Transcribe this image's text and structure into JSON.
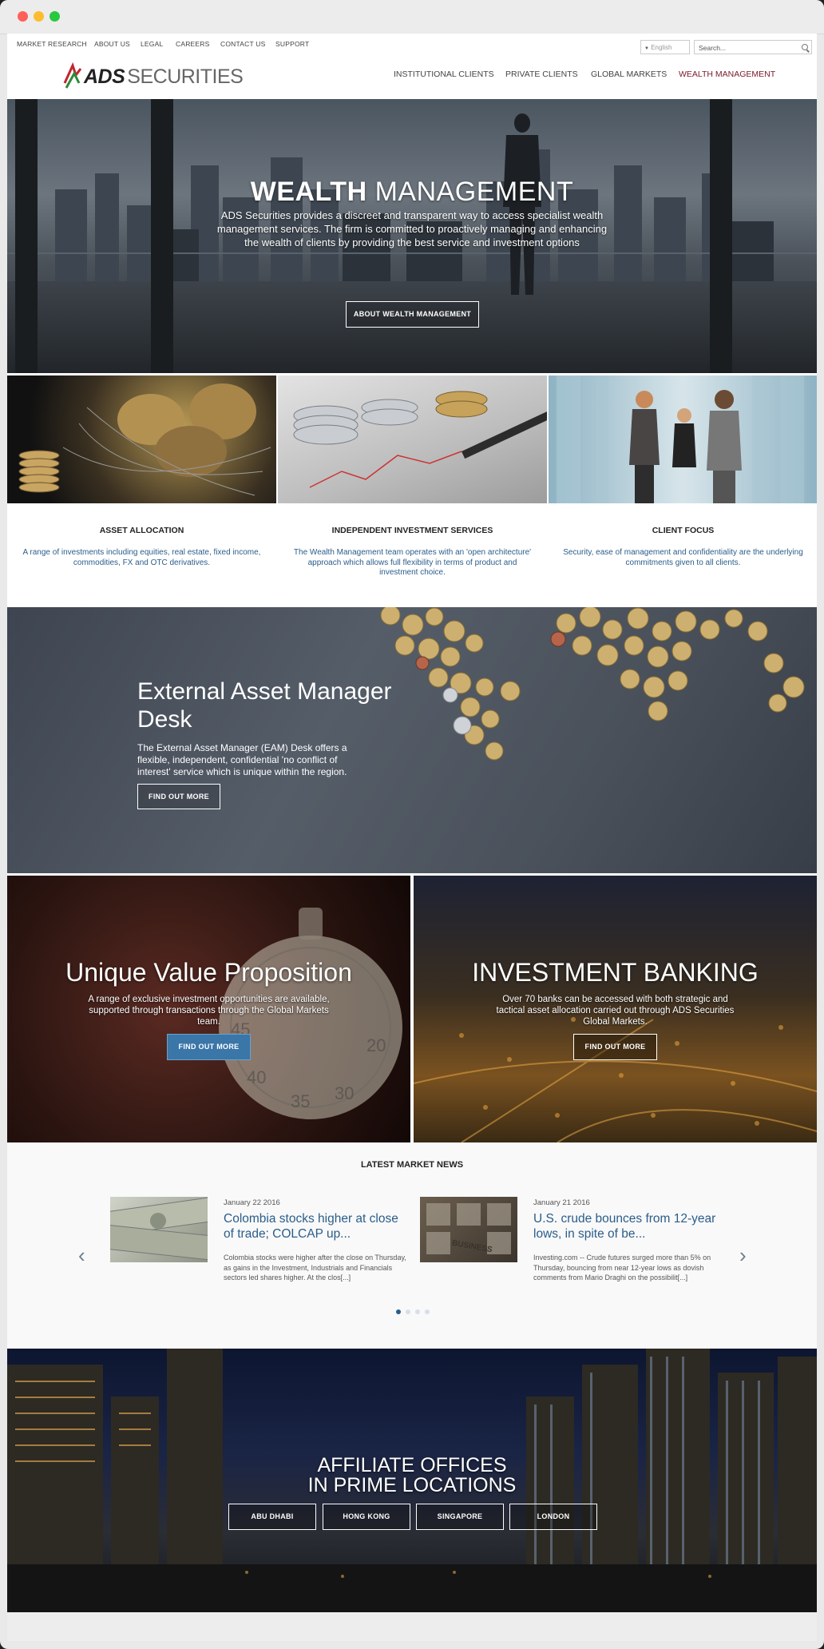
{
  "utility_nav": [
    "MARKET RESEARCH",
    "ABOUT US",
    "LEGAL",
    "CAREERS",
    "CONTACT US",
    "SUPPORT"
  ],
  "language": {
    "selected": "English"
  },
  "search": {
    "placeholder": "Search..."
  },
  "logo": {
    "brand": "ADS",
    "name": "SECURITIES"
  },
  "main_nav": [
    {
      "label": "INSTITUTIONAL CLIENTS",
      "active": false
    },
    {
      "label": "PRIVATE CLIENTS",
      "active": false
    },
    {
      "label": "GLOBAL MARKETS",
      "active": false
    },
    {
      "label": "WEALTH MANAGEMENT",
      "active": true
    }
  ],
  "hero": {
    "title_bold": "WEALTH",
    "title_rest": " MANAGEMENT",
    "text": "ADS Securities provides a discreet and transparent way to access specialist wealth management services. The firm is committed to proactively managing and enhancing the wealth of clients by providing the best service and investment options",
    "button": "ABOUT WEALTH MANAGEMENT"
  },
  "cards": [
    {
      "title": "ASSET ALLOCATION",
      "text": "A range of investments including equities, real estate, fixed income, commodities, FX and OTC derivatives."
    },
    {
      "title": "INDEPENDENT INVESTMENT SERVICES",
      "text": "The Wealth Management team operates with an 'open architecture' approach which allows full flexibility in terms of product and investment choice."
    },
    {
      "title": "CLIENT FOCUS",
      "text": "Security, ease of management and confidentiality are the underlying commitments given to all clients."
    }
  ],
  "eam": {
    "title": "External Asset Manager Desk",
    "text": "The External Asset Manager (EAM) Desk offers a flexible, independent, confidential 'no conflict of interest' service which is unique within the region.",
    "button": "FIND OUT MORE"
  },
  "uvp": {
    "title": "Unique Value Proposition",
    "text": "A range of exclusive investment opportunities are available, supported through transactions through the Global Markets team.",
    "button": "FIND OUT MORE"
  },
  "ib": {
    "title": "INVESTMENT BANKING",
    "text": "Over 70 banks can be accessed with both strategic and tactical asset allocation carried out through ADS Securities Global Markets.",
    "button": "FIND OUT MORE"
  },
  "news": {
    "heading": "LATEST MARKET NEWS",
    "prev_icon": "chevron-left-icon",
    "next_icon": "chevron-right-icon",
    "items": [
      {
        "date": "January 22 2016",
        "title": "Colombia stocks higher at close of trade; COLCAP up...",
        "excerpt": "Colombia stocks were higher after the close on Thursday, as gains in the Investment, Industrials and Financials sectors led shares higher. At the clos[...]"
      },
      {
        "date": "January 21 2016",
        "title": "U.S. crude bounces from 12-year lows, in spite of be...",
        "excerpt": "Investing.com -- Crude futures surged more than 5% on Thursday, bouncing from near 12-year lows as dovish comments from Mario Draghi on the possibilit[...]"
      }
    ],
    "pages": 4,
    "current_page": 1
  },
  "offices": {
    "title_line1": "AFFILIATE OFFICES",
    "title_line2": "IN PRIME LOCATIONS",
    "locations": [
      "ABU DHABI",
      "HONG KONG",
      "SINGAPORE",
      "LONDON"
    ]
  },
  "colors": {
    "accent": "#2a5d8a",
    "active_nav": "#7a1a2c",
    "button_fill": "#3a76a8"
  }
}
